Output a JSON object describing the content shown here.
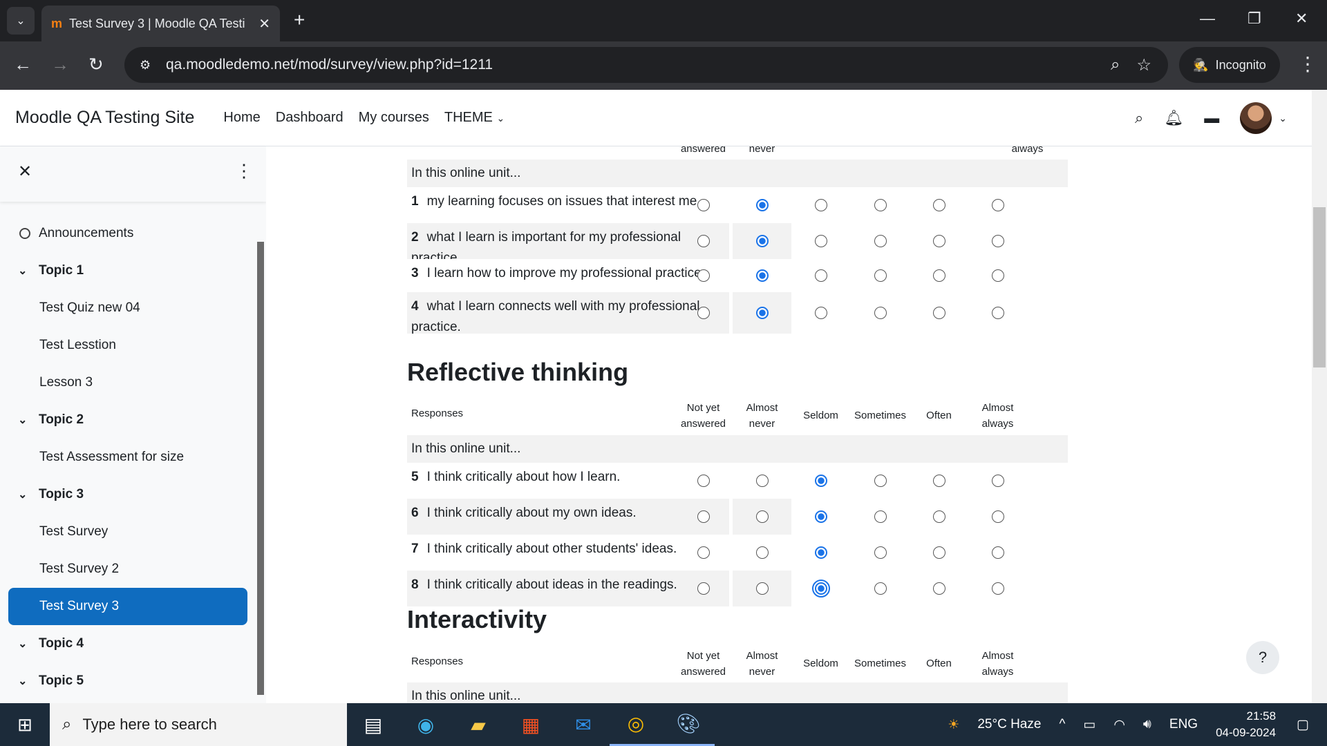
{
  "browser": {
    "tab_title": "Test Survey 3 | Moodle QA Testi",
    "url": "qa.moodledemo.net/mod/survey/view.php?id=1211",
    "incognito_label": "Incognito"
  },
  "moodle_nav": {
    "site_name": "Moodle QA Testing Site",
    "links": [
      "Home",
      "Dashboard",
      "My courses",
      "THEME"
    ]
  },
  "drawer": {
    "items": [
      {
        "label": "Announcements",
        "type": "activity-circle"
      },
      {
        "label": "Topic 1",
        "type": "section"
      },
      {
        "label": "Test Quiz new 04",
        "type": "activity"
      },
      {
        "label": "Test Lesstion",
        "type": "activity"
      },
      {
        "label": "Lesson 3",
        "type": "activity"
      },
      {
        "label": "Topic 2",
        "type": "section"
      },
      {
        "label": "Test Assessment for size",
        "type": "activity"
      },
      {
        "label": "Topic 3",
        "type": "section"
      },
      {
        "label": "Test Survey",
        "type": "activity"
      },
      {
        "label": "Test Survey 2",
        "type": "activity"
      },
      {
        "label": "Test Survey 3",
        "type": "activity-active"
      },
      {
        "label": "Topic 4",
        "type": "section"
      },
      {
        "label": "Topic 5",
        "type": "section"
      }
    ]
  },
  "survey": {
    "top_partial_headers": [
      "answered",
      "never",
      "always"
    ],
    "unit_label": "In this online unit...",
    "responses_label": "Responses",
    "columns": [
      "Not yet answered",
      "Almost never",
      "Seldom",
      "Sometimes",
      "Often",
      "Almost always"
    ],
    "section1_questions": [
      {
        "num": "1",
        "text": "my learning focuses on issues that interest me.",
        "selected": 1
      },
      {
        "num": "2",
        "text": "what I learn is important for my professional practice.",
        "selected": 1
      },
      {
        "num": "3",
        "text": "I learn how to improve my professional practice.",
        "selected": 1
      },
      {
        "num": "4",
        "text": "what I learn connects well with my professional practice.",
        "selected": 1
      }
    ],
    "section2_title": "Reflective thinking",
    "section2_questions": [
      {
        "num": "5",
        "text": "I think critically about how I learn.",
        "selected": 2
      },
      {
        "num": "6",
        "text": "I think critically about my own ideas.",
        "selected": 2
      },
      {
        "num": "7",
        "text": "I think critically about other students' ideas.",
        "selected": 2
      },
      {
        "num": "8",
        "text": "I think critically about ideas in the readings.",
        "selected": 2
      }
    ],
    "section3_title": "Interactivity",
    "help_label": "?"
  },
  "taskbar": {
    "search_placeholder": "Type here to search",
    "weather": "25°C  Haze",
    "language": "ENG",
    "time": "21:58",
    "date": "04-09-2024"
  },
  "colors": {
    "accent": "#0f6cbf",
    "radio_selected": "#1a73e8"
  }
}
